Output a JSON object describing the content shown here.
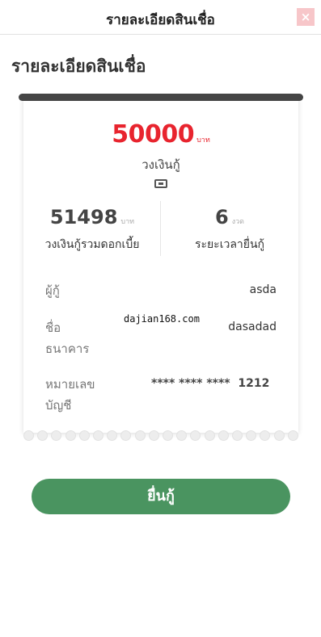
{
  "header": {
    "title": "รายละเอียดสินเชื่อ",
    "close_label": "×"
  },
  "page": {
    "heading": "รายละเอียดสินเชื่อ"
  },
  "loan": {
    "amount": "50000",
    "amount_unit": "บาท",
    "amount_label": "วงเงินกู้",
    "ticket_icon": "ticket-icon"
  },
  "stats": {
    "total": {
      "value": "51498",
      "unit": "บาท",
      "label": "วงเงินกู้รวมดอกเบี้ย"
    },
    "term": {
      "value": "6",
      "unit": "งวด",
      "label": "ระยะเวลายื่นกู้"
    }
  },
  "details": {
    "borrower_label": "ผู้กู้",
    "borrower_value": "asda",
    "bank_label_line1": "ชื่อ",
    "bank_label_line2": "ธนาคาร",
    "bank_value": "dasadad",
    "account_label_line1": "หมายเลข",
    "account_label_line2": "บัญชี",
    "account_value": "**** **** ****  1212"
  },
  "watermark": "dajian168.com",
  "actions": {
    "submit_label": "ยื่นกู้"
  },
  "colors": {
    "accent_red": "#e8242e",
    "button_green": "#4a9460",
    "close_pink": "#f7c6c9"
  }
}
